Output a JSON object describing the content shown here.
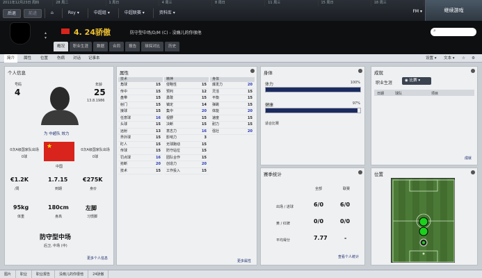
{
  "topbar": {
    "dates": [
      "2011年12月23日 周四",
      "28 周二",
      "1 周日",
      "4 周三",
      "8 周日",
      "11 周三",
      "15 周日",
      "18 周三"
    ],
    "back": "后退",
    "forward": "前进",
    "home_label": "",
    "club": "Roy",
    "nav": [
      "中超组",
      "中超联赛",
      "资料库"
    ],
    "fm": "FM",
    "continue": "继续游戏"
  },
  "header": {
    "name": "4. 24骄傲",
    "desc": "防守型中场/D/M (C) - 没瘾儿的你很他",
    "search_placeholder": ""
  },
  "tabs": [
    "概况",
    "职业生涯",
    "数据",
    "合同",
    "报告",
    "球探对比",
    "历史"
  ],
  "subtoolbar": {
    "items": [
      "简介",
      "属性",
      "位置",
      "伤病",
      "对话",
      "记事本"
    ],
    "right": [
      "设置",
      "文本"
    ]
  },
  "personal": {
    "title": "个人信息",
    "number_label": "号码",
    "number": "4",
    "age_label": "年龄",
    "age": "25",
    "birth": "13.8.1986",
    "club_link": "为 中超队 效力",
    "left_caps": "0次A级国家队出场",
    "left_goals": "0球",
    "right_caps": "0次A级国家队出场",
    "right_goals": "0球",
    "nation": "中国",
    "wage": "€1.2K",
    "wage_label": "/周",
    "contract": "1.7.15",
    "contract_label": "到期",
    "value": "€275K",
    "value_label": "身价",
    "weight": "95kg",
    "weight_label": "体重",
    "height": "180cm",
    "height_label": "身高",
    "foot": "左脚",
    "foot_label": "习惯脚",
    "position": "防守型中场",
    "positions_sub": "后卫, 中场 (中)",
    "more": "更多个人信息"
  },
  "attributes": {
    "title": "属性",
    "technical_head": "技术",
    "technical": [
      [
        "角球",
        "15"
      ],
      [
        "传中",
        "15"
      ],
      [
        "盘带",
        "15"
      ],
      [
        "射门",
        "15"
      ],
      [
        "接球",
        "15"
      ],
      [
        "任意球",
        "16"
      ],
      [
        "头球",
        "15"
      ],
      [
        "远射",
        "13"
      ],
      [
        "界外球",
        "15"
      ],
      [
        "盯人",
        "15"
      ],
      [
        "传球",
        "15"
      ],
      [
        "罚点球",
        "16"
      ],
      [
        "抢断",
        "20"
      ],
      [
        "技术",
        "15"
      ]
    ],
    "mental_head": "精神",
    "mental": [
      [
        "侵略性",
        "15"
      ],
      [
        "预判",
        "12"
      ],
      [
        "勇敢",
        "15"
      ],
      [
        "镇定",
        "14"
      ],
      [
        "集中",
        "20"
      ],
      [
        "视野",
        "15"
      ],
      [
        "决断",
        "15"
      ],
      [
        "意志力",
        "16"
      ],
      [
        "影响力",
        "3"
      ],
      [
        "无球跑动",
        "15"
      ],
      [
        "防守站位",
        "15"
      ],
      [
        "团队合作",
        "15"
      ],
      [
        "创造力",
        "20"
      ],
      [
        "工作投入",
        "15"
      ]
    ],
    "physical_head": "身体",
    "physical": [
      [
        "爆发力",
        "20"
      ],
      [
        "灵活",
        "15"
      ],
      [
        "平衡",
        "15"
      ],
      [
        "弹跳",
        "15"
      ],
      [
        "体能",
        "20"
      ],
      [
        "速度",
        "15"
      ],
      [
        "耐力",
        "15"
      ],
      [
        "强壮",
        "20"
      ]
    ],
    "more": "更多属性"
  },
  "body": {
    "title": "身体",
    "fitness_label": "体力",
    "fitness": "100%",
    "fitness_pct": 100,
    "condition_label": "健康",
    "condition": "97%",
    "condition_pct": 97,
    "note": "适合比赛"
  },
  "season": {
    "title": "赛季统计",
    "cols": [
      "全部",
      "联赛"
    ],
    "rows": [
      [
        "出场 / 进球",
        "6/0",
        "6/0"
      ],
      [
        "黄 / 红牌",
        "0/0",
        "0/0"
      ],
      [
        "平均得分",
        "7.77",
        "-"
      ]
    ],
    "more": "查看个人统计"
  },
  "career": {
    "title": "成就",
    "tab": "职业生涯",
    "dropdown": "比赛",
    "cols": [
      "日期",
      "球队",
      "项目"
    ],
    "more": "成就"
  },
  "position_panel": {
    "title": "位置"
  },
  "bottom": [
    "图片",
    "职业",
    "职业报告",
    "没瘾儿的你很他",
    "24骄傲"
  ]
}
